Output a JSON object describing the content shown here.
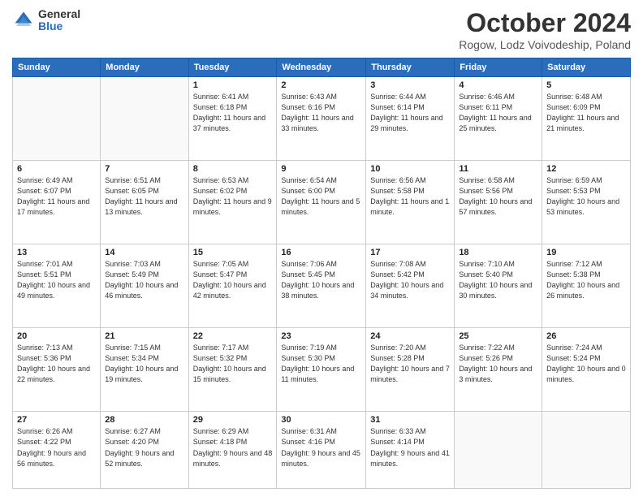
{
  "header": {
    "logo_general": "General",
    "logo_blue": "Blue",
    "month_title": "October 2024",
    "location": "Rogow, Lodz Voivodeship, Poland"
  },
  "days_of_week": [
    "Sunday",
    "Monday",
    "Tuesday",
    "Wednesday",
    "Thursday",
    "Friday",
    "Saturday"
  ],
  "weeks": [
    [
      {
        "day": "",
        "detail": ""
      },
      {
        "day": "",
        "detail": ""
      },
      {
        "day": "1",
        "detail": "Sunrise: 6:41 AM\nSunset: 6:18 PM\nDaylight: 11 hours and 37 minutes."
      },
      {
        "day": "2",
        "detail": "Sunrise: 6:43 AM\nSunset: 6:16 PM\nDaylight: 11 hours and 33 minutes."
      },
      {
        "day": "3",
        "detail": "Sunrise: 6:44 AM\nSunset: 6:14 PM\nDaylight: 11 hours and 29 minutes."
      },
      {
        "day": "4",
        "detail": "Sunrise: 6:46 AM\nSunset: 6:11 PM\nDaylight: 11 hours and 25 minutes."
      },
      {
        "day": "5",
        "detail": "Sunrise: 6:48 AM\nSunset: 6:09 PM\nDaylight: 11 hours and 21 minutes."
      }
    ],
    [
      {
        "day": "6",
        "detail": "Sunrise: 6:49 AM\nSunset: 6:07 PM\nDaylight: 11 hours and 17 minutes."
      },
      {
        "day": "7",
        "detail": "Sunrise: 6:51 AM\nSunset: 6:05 PM\nDaylight: 11 hours and 13 minutes."
      },
      {
        "day": "8",
        "detail": "Sunrise: 6:53 AM\nSunset: 6:02 PM\nDaylight: 11 hours and 9 minutes."
      },
      {
        "day": "9",
        "detail": "Sunrise: 6:54 AM\nSunset: 6:00 PM\nDaylight: 11 hours and 5 minutes."
      },
      {
        "day": "10",
        "detail": "Sunrise: 6:56 AM\nSunset: 5:58 PM\nDaylight: 11 hours and 1 minute."
      },
      {
        "day": "11",
        "detail": "Sunrise: 6:58 AM\nSunset: 5:56 PM\nDaylight: 10 hours and 57 minutes."
      },
      {
        "day": "12",
        "detail": "Sunrise: 6:59 AM\nSunset: 5:53 PM\nDaylight: 10 hours and 53 minutes."
      }
    ],
    [
      {
        "day": "13",
        "detail": "Sunrise: 7:01 AM\nSunset: 5:51 PM\nDaylight: 10 hours and 49 minutes."
      },
      {
        "day": "14",
        "detail": "Sunrise: 7:03 AM\nSunset: 5:49 PM\nDaylight: 10 hours and 46 minutes."
      },
      {
        "day": "15",
        "detail": "Sunrise: 7:05 AM\nSunset: 5:47 PM\nDaylight: 10 hours and 42 minutes."
      },
      {
        "day": "16",
        "detail": "Sunrise: 7:06 AM\nSunset: 5:45 PM\nDaylight: 10 hours and 38 minutes."
      },
      {
        "day": "17",
        "detail": "Sunrise: 7:08 AM\nSunset: 5:42 PM\nDaylight: 10 hours and 34 minutes."
      },
      {
        "day": "18",
        "detail": "Sunrise: 7:10 AM\nSunset: 5:40 PM\nDaylight: 10 hours and 30 minutes."
      },
      {
        "day": "19",
        "detail": "Sunrise: 7:12 AM\nSunset: 5:38 PM\nDaylight: 10 hours and 26 minutes."
      }
    ],
    [
      {
        "day": "20",
        "detail": "Sunrise: 7:13 AM\nSunset: 5:36 PM\nDaylight: 10 hours and 22 minutes."
      },
      {
        "day": "21",
        "detail": "Sunrise: 7:15 AM\nSunset: 5:34 PM\nDaylight: 10 hours and 19 minutes."
      },
      {
        "day": "22",
        "detail": "Sunrise: 7:17 AM\nSunset: 5:32 PM\nDaylight: 10 hours and 15 minutes."
      },
      {
        "day": "23",
        "detail": "Sunrise: 7:19 AM\nSunset: 5:30 PM\nDaylight: 10 hours and 11 minutes."
      },
      {
        "day": "24",
        "detail": "Sunrise: 7:20 AM\nSunset: 5:28 PM\nDaylight: 10 hours and 7 minutes."
      },
      {
        "day": "25",
        "detail": "Sunrise: 7:22 AM\nSunset: 5:26 PM\nDaylight: 10 hours and 3 minutes."
      },
      {
        "day": "26",
        "detail": "Sunrise: 7:24 AM\nSunset: 5:24 PM\nDaylight: 10 hours and 0 minutes."
      }
    ],
    [
      {
        "day": "27",
        "detail": "Sunrise: 6:26 AM\nSunset: 4:22 PM\nDaylight: 9 hours and 56 minutes."
      },
      {
        "day": "28",
        "detail": "Sunrise: 6:27 AM\nSunset: 4:20 PM\nDaylight: 9 hours and 52 minutes."
      },
      {
        "day": "29",
        "detail": "Sunrise: 6:29 AM\nSunset: 4:18 PM\nDaylight: 9 hours and 48 minutes."
      },
      {
        "day": "30",
        "detail": "Sunrise: 6:31 AM\nSunset: 4:16 PM\nDaylight: 9 hours and 45 minutes."
      },
      {
        "day": "31",
        "detail": "Sunrise: 6:33 AM\nSunset: 4:14 PM\nDaylight: 9 hours and 41 minutes."
      },
      {
        "day": "",
        "detail": ""
      },
      {
        "day": "",
        "detail": ""
      }
    ]
  ]
}
